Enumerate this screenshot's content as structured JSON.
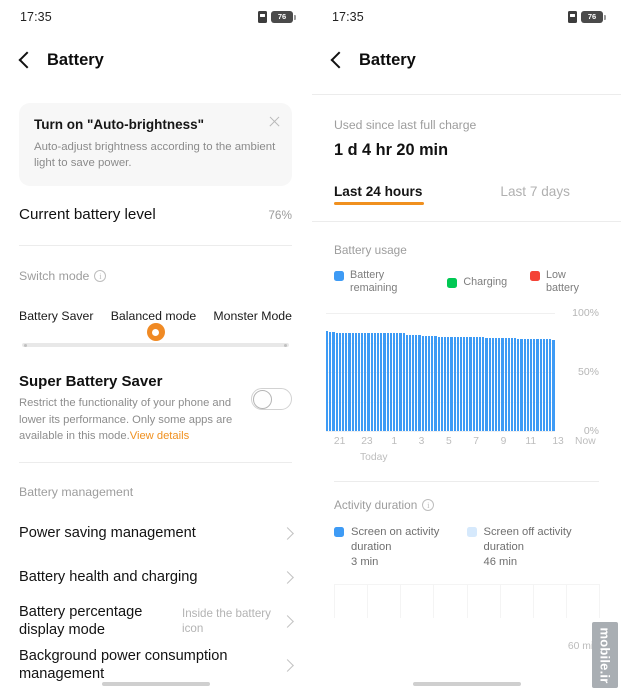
{
  "status": {
    "time": "17:35",
    "battery_percent": "76",
    "sim_icon": "sim-card-icon",
    "battery_icon": "battery-icon"
  },
  "left": {
    "nav": {
      "title": "Battery",
      "back_icon": "back-chevron-icon"
    },
    "tip_card": {
      "title": "Turn on \"Auto-brightness\"",
      "desc": "Auto-adjust brightness according to the ambient light to save power.",
      "close_icon": "close-icon"
    },
    "battery_level": {
      "label": "Current battery level",
      "value": "76%"
    },
    "switch_mode": {
      "label": "Switch mode",
      "info_icon": "info-icon",
      "info_glyph": "i"
    },
    "modes": [
      "Battery Saver",
      "Balanced mode",
      "Monster Mode"
    ],
    "slider": {
      "selected_index": 1,
      "accent": "#F08A24"
    },
    "super_saver": {
      "title": "Super Battery Saver",
      "desc": "Restrict the functionality of your phone and lower its performance. Only some apps are available in this mode.",
      "link": "View details",
      "toggle_state": "off"
    },
    "management_label": "Battery management",
    "items": [
      {
        "label": "Power saving management",
        "sub": "",
        "chevron": "chevron-right-icon"
      },
      {
        "label": "Battery health and charging",
        "sub": "",
        "chevron": "chevron-right-icon"
      },
      {
        "label": "Battery percentage display mode",
        "sub": "Inside the battery icon",
        "chevron": "chevron-right-icon"
      },
      {
        "label": "Background power consumption management",
        "sub": "",
        "chevron": "chevron-right-icon"
      }
    ]
  },
  "right": {
    "nav": {
      "title": "Battery",
      "back_icon": "back-chevron-icon"
    },
    "used_since": {
      "label": "Used since last full charge",
      "value": "1 d 4 hr 20 min"
    },
    "tabs": [
      {
        "label": "Last 24 hours",
        "active": true
      },
      {
        "label": "Last 7 days",
        "active": false
      }
    ],
    "usage_title": "Battery usage",
    "legend": [
      {
        "label": "Battery remaining",
        "color": "#3E9BF5"
      },
      {
        "label": "Charging",
        "color": "#00C853"
      },
      {
        "label": "Low battery",
        "color": "#F44336"
      }
    ],
    "activity": {
      "title": "Activity duration",
      "info_icon": "info-icon",
      "info_glyph": "i",
      "items": [
        {
          "label": "Screen on activity duration",
          "value": "3 min",
          "color": "#3E9BF5"
        },
        {
          "label": "Screen off activity duration",
          "value": "46 min",
          "color": "#D6E9FC"
        }
      ],
      "axis_max_label": "60 min"
    },
    "watermark": "mobile.ir"
  },
  "chart_data": {
    "type": "bar",
    "title": "Battery usage",
    "xlabel": "Today",
    "ylabel": "",
    "ylim": [
      0,
      100
    ],
    "ytick_labels": [
      "100%",
      "50%",
      "0%"
    ],
    "ytick_values": [
      100,
      50,
      0
    ],
    "grid": true,
    "legend_position": "top-left",
    "xtick_labels": [
      "21",
      "23",
      "1",
      "3",
      "5",
      "7",
      "9",
      "11",
      "13",
      "Now"
    ],
    "series": [
      {
        "name": "Battery remaining",
        "color": "#3E9BF5",
        "values": [
          85,
          84,
          84,
          83,
          83,
          83,
          83,
          83,
          83,
          83,
          83,
          83,
          83,
          83,
          83,
          83,
          83,
          83,
          83,
          83,
          83,
          83,
          83,
          83,
          83,
          82,
          82,
          82,
          82,
          82,
          81,
          81,
          81,
          81,
          81,
          80,
          80,
          80,
          80,
          80,
          80,
          80,
          80,
          80,
          80,
          80,
          80,
          80,
          80,
          80,
          79,
          79,
          79,
          79,
          79,
          79,
          79,
          79,
          79,
          79,
          78,
          78,
          78,
          78,
          78,
          78,
          78,
          78,
          78,
          78,
          78,
          77
        ]
      }
    ]
  }
}
